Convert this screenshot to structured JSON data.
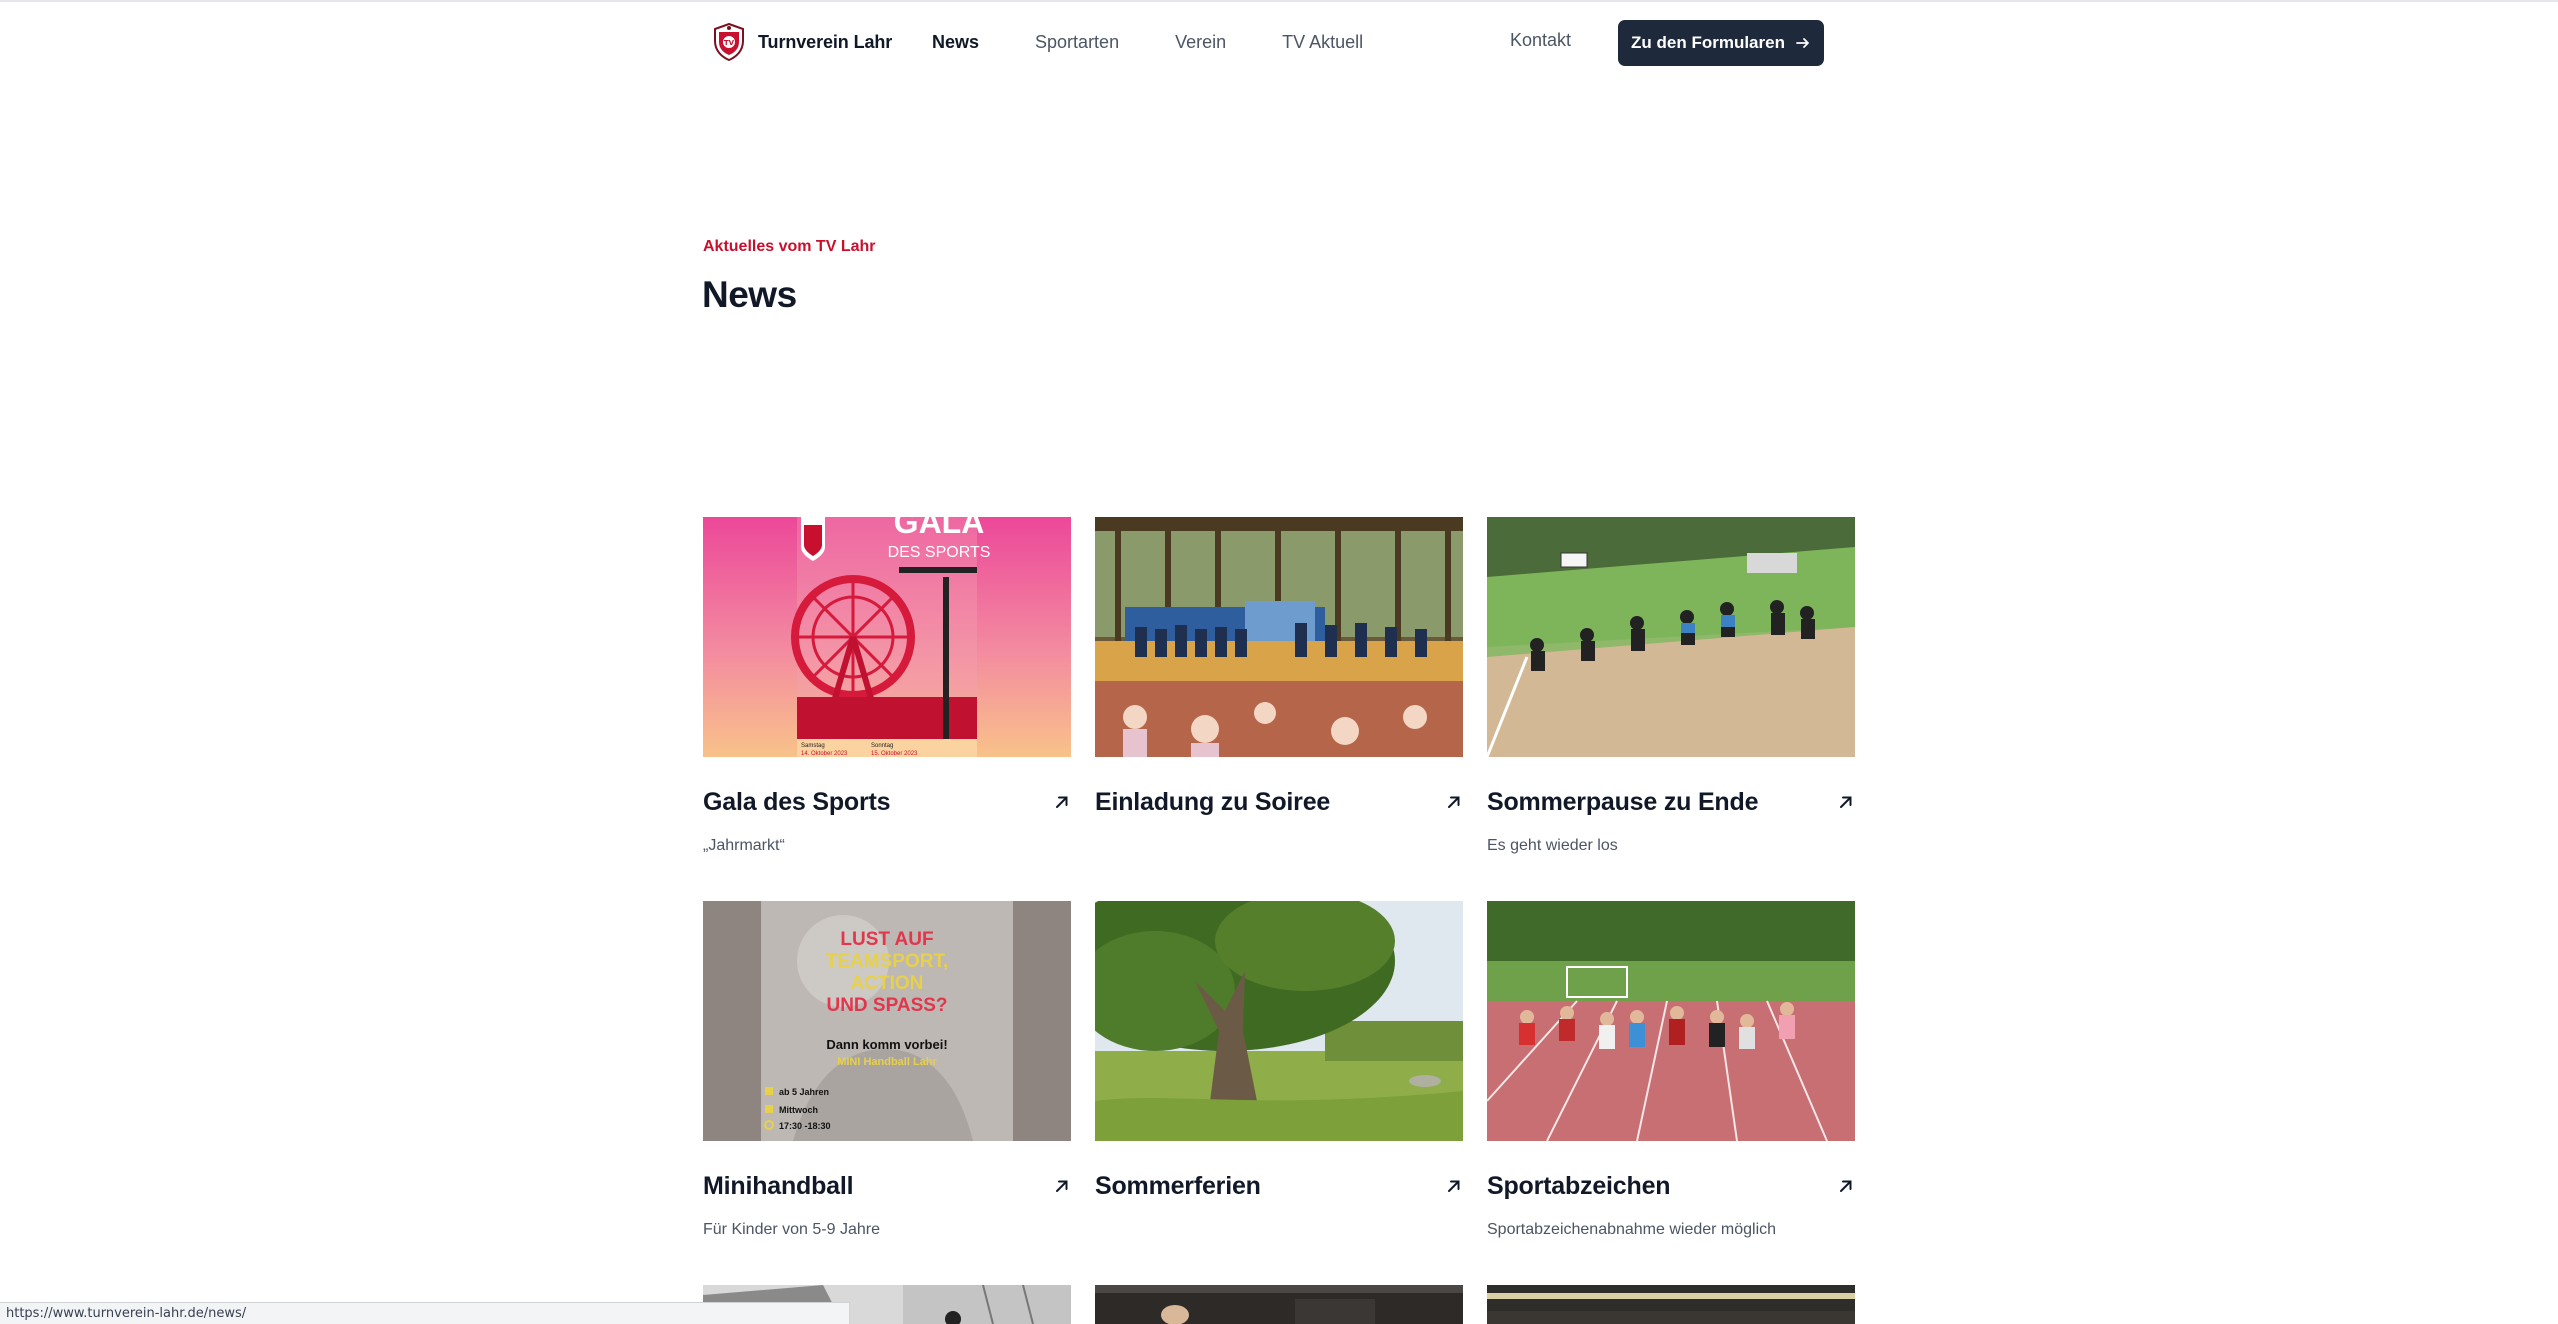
{
  "header": {
    "brand_name": "Turnverein Lahr",
    "nav": [
      {
        "label": "News",
        "active": true
      },
      {
        "label": "Sportarten",
        "active": false
      },
      {
        "label": "Verein",
        "active": false
      },
      {
        "label": "TV Aktuell",
        "active": false
      }
    ],
    "kontakt_label": "Kontakt",
    "cta_label": "Zu den Formularen",
    "cta_icon": "arrow-right-icon"
  },
  "hero": {
    "eyebrow": "Aktuelles vom TV Lahr",
    "title": "News"
  },
  "posts": [
    {
      "title": "Gala des Sports",
      "subtitle": "„Jahrmarkt“",
      "image": "gala-poster",
      "image_text": {
        "headline": "GALA",
        "sub": "DES SPORTS",
        "date1_day": "Samstag",
        "date1": "14. Oktober 2023",
        "date2_day": "Sonntag",
        "date2": "15. Oktober 2023"
      }
    },
    {
      "title": "Einladung zu Soiree",
      "subtitle": "",
      "image": "soiree-photo"
    },
    {
      "title": "Sommerpause zu Ende",
      "subtitle": "Es geht wieder los",
      "image": "longjump-photo"
    },
    {
      "title": "Minihandball",
      "subtitle": "Für Kinder von 5-9 Jahre",
      "image": "minihandball-poster",
      "image_text": {
        "l1": "LUST AUF",
        "l2": "TEAMSPORT,",
        "l3": "ACTION",
        "l4": "UND SPASS?",
        "l5": "Dann komm vorbei!",
        "l6": "MINI Handball Lahr",
        "age": "ab 5 Jahren",
        "day": "Mittwoch",
        "time": "17:30 -18:30"
      }
    },
    {
      "title": "Sommerferien",
      "subtitle": "",
      "image": "tree-photo"
    },
    {
      "title": "Sportabzeichen",
      "subtitle": "Sportabzeichenabnahme wieder möglich",
      "image": "track-photo"
    },
    {
      "title": "",
      "subtitle": "",
      "image": "building-photo"
    },
    {
      "title": "",
      "subtitle": "",
      "image": "gym-photo"
    },
    {
      "title": "",
      "subtitle": "",
      "image": "hall-photo"
    }
  ],
  "colors": {
    "accent": "#c8102e",
    "cta_bg": "#1e293b",
    "text": "#111827",
    "muted": "#4b5563"
  },
  "status_url": "https://www.turnverein-lahr.de/news/"
}
